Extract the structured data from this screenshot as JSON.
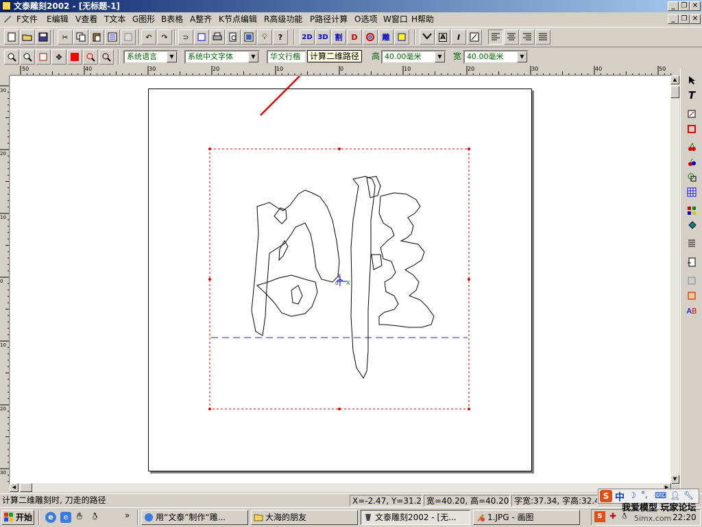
{
  "window": {
    "title": "文泰雕刻2002 - [无标题-1]"
  },
  "menu": [
    "F文件",
    "E编辑",
    "V查看",
    "T文本",
    "G图形",
    "B表格",
    "A整齐",
    "K节点编辑",
    "R高级功能",
    "P路径计算",
    "O选项",
    "W窗口",
    "H帮助"
  ],
  "toolbar": {
    "btn_2d": "2D",
    "btn_3d": "3D",
    "btn_cut": "割",
    "btn_d": "D",
    "btn_carve": "雕",
    "language": "系统语言",
    "font": "系统中文字体",
    "font_name": "华文行楷",
    "tooltip": "计算二维路径",
    "height_label": "高",
    "height_value": "40.00毫米",
    "width_label": "宽",
    "width_value": "40.00毫米"
  },
  "ruler": {
    "h_ticks": [
      "50",
      "40",
      "30",
      "20",
      "10",
      "0",
      "10",
      "20",
      "30",
      "40",
      "50"
    ],
    "v_ticks": [
      "30",
      "20",
      "10",
      "0",
      "10",
      "20",
      "30"
    ]
  },
  "canvas": {
    "axis_y": "Y",
    "axis_x": "X",
    "axis_o": "0"
  },
  "status": {
    "message": "计算二维雕刻时, 刀走的路径",
    "coords": "X=-2.47, Y=31.29",
    "size": "宽=40.20, 高=40.20",
    "char_size": "字宽:37.34, 字高:32.4"
  },
  "taskbar": {
    "start": "开始",
    "more": "»",
    "tasks": [
      "用“文泰”制作“雕...",
      "大海的朋友",
      "文泰雕刻2002 - [无...",
      "1.JPG - 画图"
    ],
    "time": "22:20",
    "ime": "中",
    "watermark_1": "我爱模型 玩家论坛",
    "watermark_2": "5imx.com"
  },
  "colors": {
    "titlebar_start": "#0a246a",
    "titlebar_end": "#a6caf0",
    "selection": "#e00000",
    "baseline": "#1a2a9a",
    "tooltip_bg": "#ffffe1"
  }
}
